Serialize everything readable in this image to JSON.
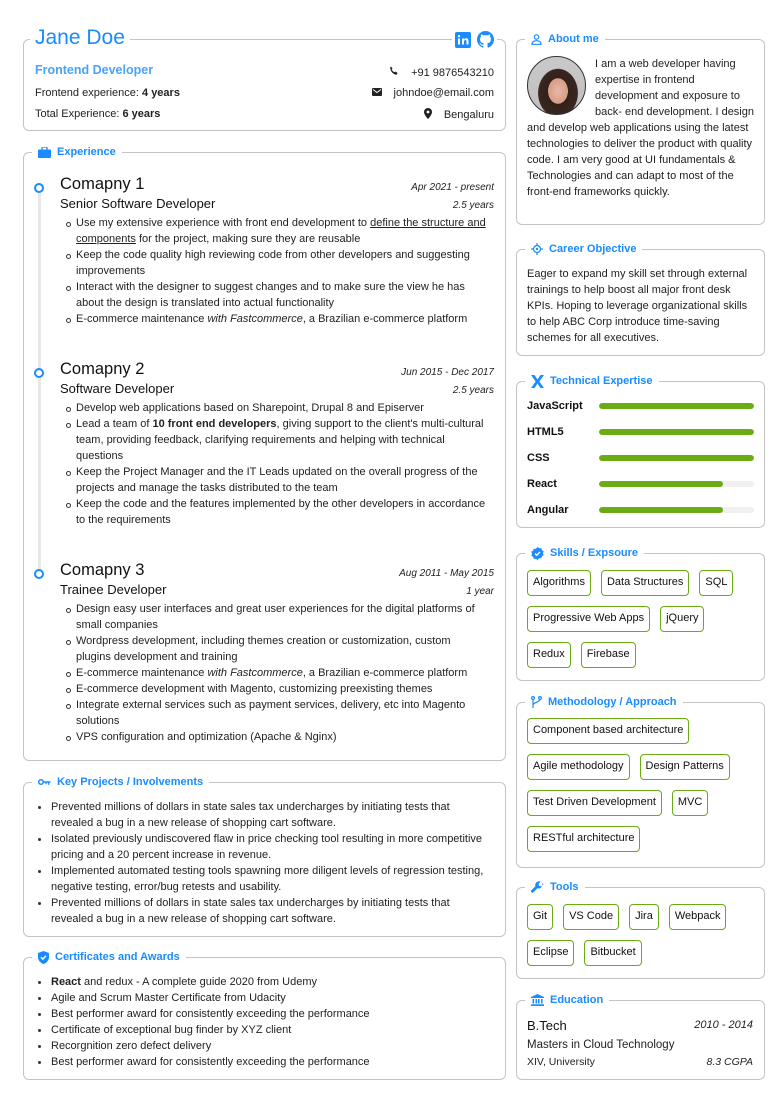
{
  "header": {
    "name": "Jane Doe",
    "role": "Frontend Developer",
    "frontend_experience_label": "Frontend experience: ",
    "frontend_experience_value": "4 years",
    "total_experience_label": "Total Experience: ",
    "total_experience_value": "6 years",
    "phone": "+91 9876543210",
    "email": "johndoe@email.com",
    "location": "Bengaluru",
    "social": [
      "linkedin-icon",
      "github-icon"
    ]
  },
  "experience": {
    "title": "Experience",
    "jobs": [
      {
        "company": "Comapny 1",
        "title": "Senior Software Developer",
        "period": "Apr 2021 - present",
        "duration": "2.5 years",
        "bullets": [
          {
            "pre": "Use my extensive experience with front end development to ",
            "underline": "define the structure and components",
            "post": " for the project, making sure they are reusable"
          },
          {
            "text": "Keep the code quality high reviewing code from other developers and suggesting improvements"
          },
          {
            "text": "Interact with the designer to suggest changes and to make sure the view he has about the design is translated into actual functionality"
          },
          {
            "pre": "E-commerce maintenance ",
            "italic": "with Fastcommerce",
            "post": ", a Brazilian e-commerce platform"
          }
        ]
      },
      {
        "company": "Comapny 2",
        "title": "Software Developer",
        "period": "Jun 2015 - Dec 2017",
        "duration": "2.5 years",
        "bullets": [
          {
            "text": "Develop web applications based on Sharepoint, Drupal 8 and Episerver"
          },
          {
            "pre": "Lead a team of ",
            "bold": "10 front end developers",
            "post": ", giving support to the client's multi-cultural team, providing feedback, clarifying requirements and helping with technical questions"
          },
          {
            "text": "Keep the Project Manager and the IT Leads updated on the overall progress of the projects and manage the tasks distributed to the team"
          },
          {
            "text": "Keep the code and the features implemented by the other developers in accordance to the requirements"
          }
        ]
      },
      {
        "company": "Comapny 3",
        "title": "Trainee Developer",
        "period": "Aug 2011 - May 2015",
        "duration": "1 year",
        "bullets": [
          {
            "text": "Design easy user interfaces and great user experiences for the digital platforms of small companies"
          },
          {
            "text": "Wordpress development, including themes creation or customization, custom plugins development and training"
          },
          {
            "pre": "E-commerce maintenance ",
            "italic": "with Fastcommerce",
            "post": ", a Brazilian e-commerce platform"
          },
          {
            "text": "E-commerce development with Magento, customizing preexisting themes"
          },
          {
            "text": "Integrate external services such as payment services, delivery, etc into Magento solutions"
          },
          {
            "text": "VPS configuration and optimization (Apache & Nginx)"
          }
        ]
      }
    ]
  },
  "projects": {
    "title": "Key Projects / Involvements",
    "items": [
      "Prevented millions of dollars in state sales tax undercharges by initiating tests that revealed a bug in a new release of shopping cart software.",
      "Isolated previously undiscovered flaw in price checking tool resulting in more competitive pricing and a 20 percent increase in revenue.",
      "Implemented automated testing tools spawning more diligent levels of regression testing, negative testing, error/bug retests and usability.",
      "Prevented millions of dollars in state sales tax undercharges by initiating tests that revealed a bug in a new release of shopping cart software."
    ]
  },
  "certificates": {
    "title": "Certificates and Awards",
    "first_bold": "React",
    "first_rest": " and redux - A complete guide 2020 from Udemy",
    "items": [
      "Agile and Scrum Master Certificate from Udacity",
      "Best performer award for consistently exceeding the performance",
      "Certificate of exceptional bug finder by XYZ client",
      "Recorgnition zero defect delivery",
      "Best performer award for consistently exceeding the performance"
    ]
  },
  "about": {
    "title": "About me",
    "text": "I am a web developer having expertise in frontend development and exposure to back- end development. I design and develop web applications using the latest technologies to deliver the product with quality code. I am very good at UI fundamentals & Technologies and can adapt to most of the front-end frameworks quickly."
  },
  "career": {
    "title": "Career Objective",
    "text": "Eager to expand my skill set through external trainings to help boost all major front desk KPIs. Hoping to leverage organizational skills to help ABC Corp introduce time-saving schemes for all executives."
  },
  "technical": {
    "title": "Technical Expertise",
    "bar_color": "#6aac14",
    "skills": [
      {
        "name": "JavaScript",
        "level": 100
      },
      {
        "name": "HTML5",
        "level": 100
      },
      {
        "name": "CSS",
        "level": 100
      },
      {
        "name": "React",
        "level": 80
      },
      {
        "name": "Angular",
        "level": 80
      }
    ]
  },
  "skills": {
    "title": "Skills / Expsoure",
    "items": [
      "Algorithms",
      "Data Structures",
      "SQL",
      "Progressive Web Apps",
      "jQuery",
      "Redux",
      "Firebase"
    ]
  },
  "methodology": {
    "title": "Methodology / Approach",
    "items": [
      "Component based architecture",
      "Agile methodology",
      "Design Patterns",
      "Test Driven Development",
      "MVC",
      "RESTful architecture"
    ]
  },
  "tools": {
    "title": "Tools",
    "items": [
      "Git",
      "VS Code",
      "Jira",
      "Webpack",
      "Eclipse",
      "Bitbucket"
    ]
  },
  "education": {
    "title": "Education",
    "degree": "B.Tech",
    "years": "2010 - 2014",
    "specialization": "Masters in Cloud Technology",
    "university": "XIV, University",
    "gpa": "8.3 CGPA"
  },
  "colors": {
    "accent": "#1a8cff",
    "role": "#4aa3f5",
    "chip_border": "#6aac14"
  }
}
